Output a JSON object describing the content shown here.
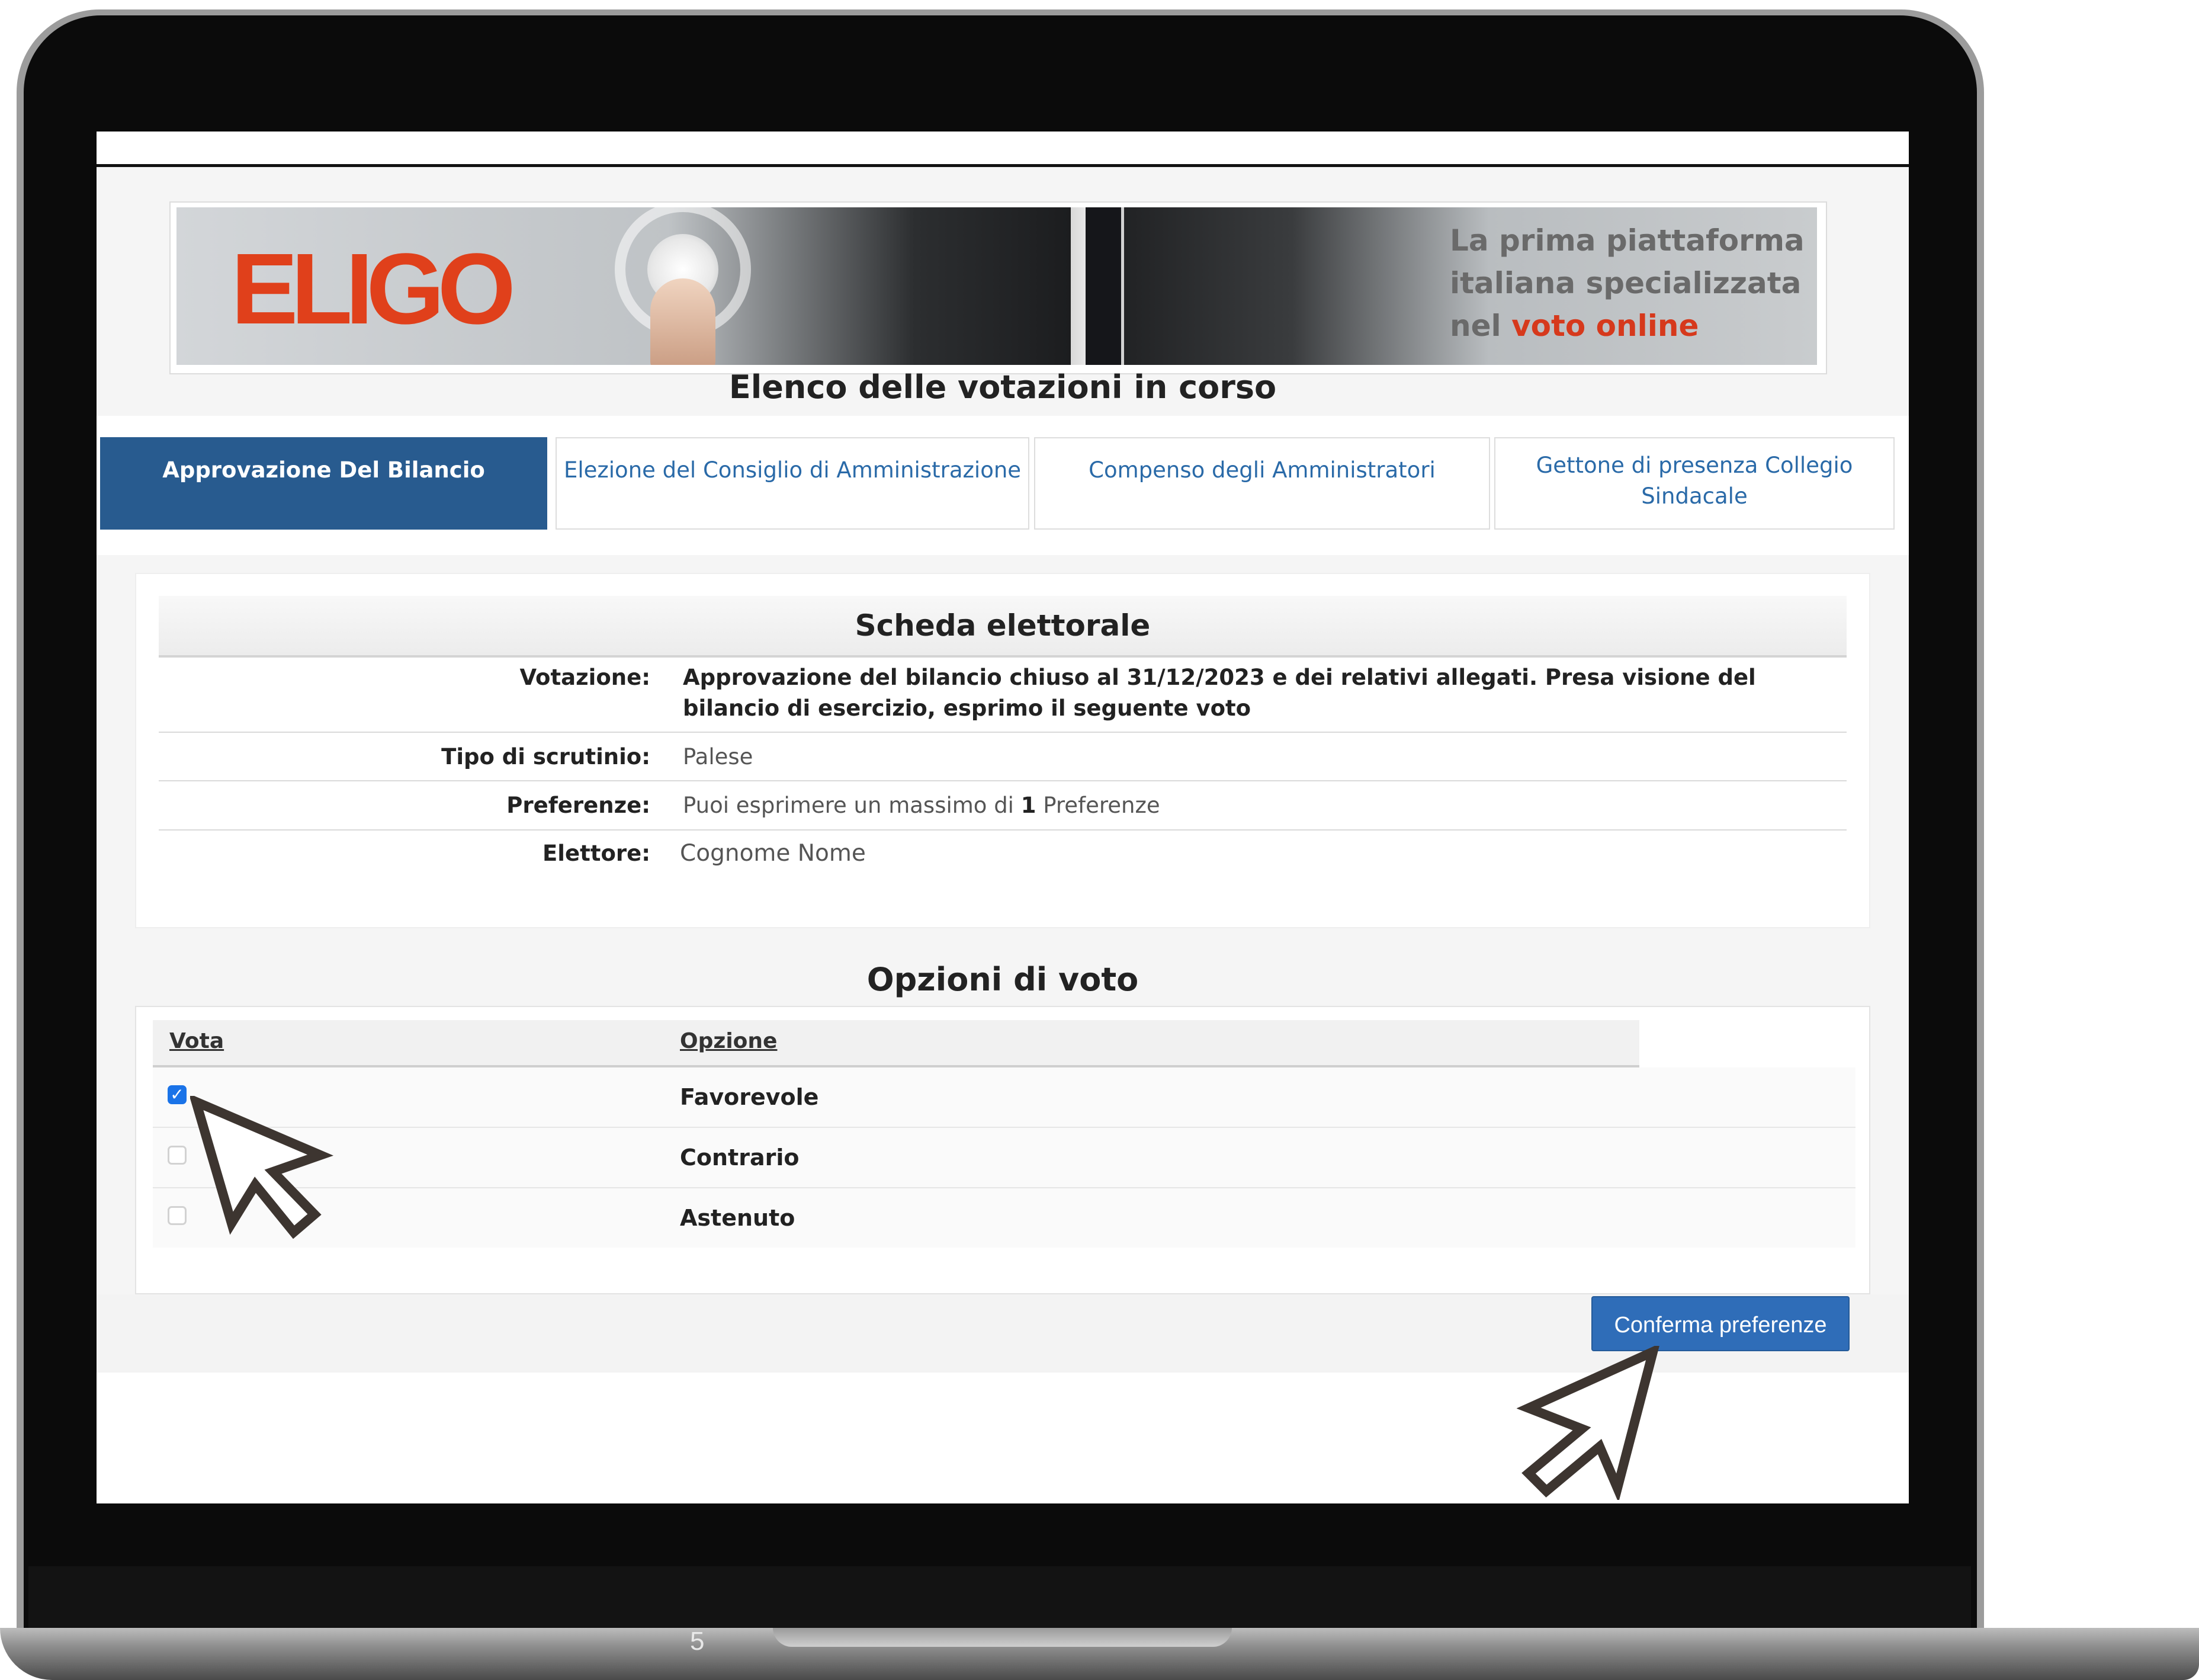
{
  "banner": {
    "logo": "ELIGO",
    "tagline_line1": "La prima piattaforma",
    "tagline_line2": "italiana specializzata",
    "tagline_line3_prefix": "nel ",
    "tagline_line3_highlight": "voto online"
  },
  "page_title": "Elenco delle votazioni in corso",
  "tabs": [
    {
      "label": "Approvazione Del Bilancio",
      "active": true
    },
    {
      "label": "Elezione del Consiglio di Amministrazione",
      "active": false
    },
    {
      "label": "Compenso degli Amministratori",
      "active": false
    },
    {
      "label": "Gettone di presenza Collegio Sindacale",
      "active": false
    }
  ],
  "ballot": {
    "title": "Scheda elettorale",
    "votazione_label": "Votazione:",
    "votazione_value": "Approvazione del bilancio chiuso al 31/12/2023 e dei relativi allegati. Presa visione del bilancio di esercizio, esprimo il seguente voto",
    "scrutinio_label": "Tipo di scrutinio:",
    "scrutinio_value": "Palese",
    "preferenze_label": "Preferenze:",
    "preferenze_prefix": "Puoi esprimere un massimo di ",
    "preferenze_number": "1",
    "preferenze_suffix": " Preferenze",
    "elettore_label": "Elettore:",
    "elettore_value": "Cognome Nome"
  },
  "options": {
    "title": "Opzioni di voto",
    "col_vota": "Vota",
    "col_opzione": "Opzione",
    "rows": [
      {
        "label": "Favorevole",
        "checked": true
      },
      {
        "label": "Contrario",
        "checked": false
      },
      {
        "label": "Astenuto",
        "checked": false
      }
    ]
  },
  "confirm_button": "Conferma preferenze",
  "page_number": "5",
  "colors": {
    "active_tab": "#285b8f",
    "link": "#2a6aa8",
    "button": "#2f6db8",
    "brand_red": "#e0401b",
    "checkbox_checked": "#1a73e8"
  },
  "icons": [
    "check-icon",
    "arrow-cursor-icon"
  ]
}
